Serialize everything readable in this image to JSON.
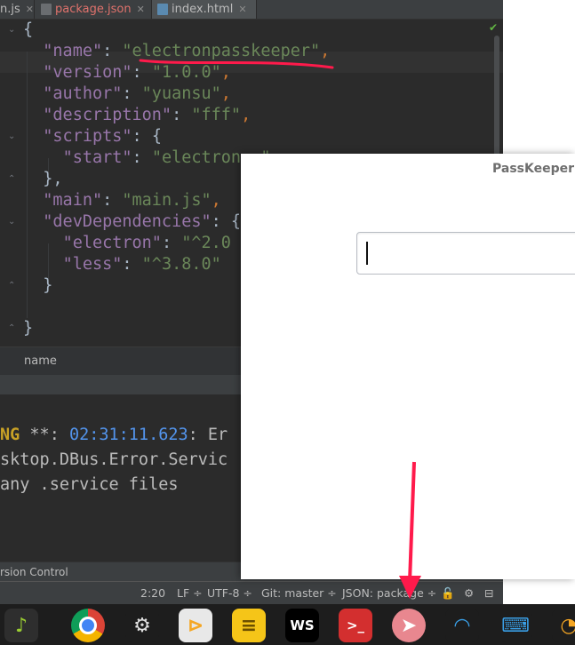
{
  "tabs": [
    {
      "label": "n.js"
    },
    {
      "label": "package.json",
      "modified": true
    },
    {
      "label": "index.html"
    }
  ],
  "code_lines": [
    {
      "indent": "",
      "parts": [
        {
          "t": "{",
          "c": "p"
        }
      ]
    },
    {
      "indent": "  ",
      "key": "\"name\"",
      "value": "\"electronpasskeeper\"",
      "tail": ","
    },
    {
      "indent": "  ",
      "key": "\"version\"",
      "value": "\"1.0.0\"",
      "tail": ","
    },
    {
      "indent": "  ",
      "key": "\"author\"",
      "value": "\"yuansu\"",
      "tail": ","
    },
    {
      "indent": "  ",
      "key": "\"description\"",
      "value": "\"fff\"",
      "tail": ","
    },
    {
      "indent": "  ",
      "key": "\"scripts\"",
      "value": "{",
      "tail": ""
    },
    {
      "indent": "    ",
      "key": "\"start\"",
      "value": "\"electron .\"",
      "tail": ""
    },
    {
      "indent": "  ",
      "raw": "},"
    },
    {
      "indent": "  ",
      "key": "\"main\"",
      "value": "\"main.js\"",
      "tail": ","
    },
    {
      "indent": "  ",
      "key": "\"devDependencies\"",
      "value": "{",
      "tail": ""
    },
    {
      "indent": "    ",
      "key": "\"electron\"",
      "value": "\"^2.0",
      "tail": ""
    },
    {
      "indent": "    ",
      "key": "\"less\"",
      "value": "\"^3.8.0\"",
      "tail": ""
    },
    {
      "indent": "  ",
      "raw": "}"
    },
    {
      "indent": "",
      "raw": ""
    },
    {
      "indent": "",
      "raw": "}"
    }
  ],
  "breadcrumb": "name",
  "console": {
    "line1_prefix": "NG",
    "line1_mid": " **: ",
    "line1_time": "02:31:11.623",
    "line1_end": ": Er",
    "line2": "sktop.DBus.Error.Servic",
    "line3": "any .service files"
  },
  "tool_tab": "rsion Control",
  "status": {
    "position": "2:20",
    "line_sep": "LF ÷",
    "encoding": "UTF-8 ÷",
    "git": "Git: master ÷",
    "schema": "JSON: package ÷"
  },
  "window": {
    "title": "PassKeeper",
    "input_value": ""
  },
  "dock": [
    {
      "name": "music-icon",
      "color": "#2e2e2e",
      "glyph": "♪",
      "fg": "#9acd32"
    },
    {
      "name": "chrome-icon",
      "color": "#1d1d1d",
      "glyph": "",
      "fg": "#fff"
    },
    {
      "name": "settings-icon",
      "color": "#1d1d1d",
      "glyph": "⚙",
      "fg": "#e0e0e0"
    },
    {
      "name": "vscode-icon",
      "color": "#e8e8e8",
      "glyph": "⊳",
      "fg": "#f5a623"
    },
    {
      "name": "notes-icon",
      "color": "#f5c518",
      "glyph": "≡",
      "fg": "#6b4f00"
    },
    {
      "name": "webstorm-icon",
      "color": "#000000",
      "glyph": "WS",
      "fg": "#ffffff"
    },
    {
      "name": "terminal-icon",
      "color": "#d32f2f",
      "glyph": ">_",
      "fg": "#ffffff"
    },
    {
      "name": "paperplane-icon",
      "color": "#e8878f",
      "glyph": "➤",
      "fg": "#ffffff"
    },
    {
      "name": "wifi-icon",
      "color": "#1d1d1d",
      "glyph": "◠",
      "fg": "#3aa0e8"
    },
    {
      "name": "keyboard-icon",
      "color": "#1d1d1d",
      "glyph": "⌨",
      "fg": "#3aa0e8"
    },
    {
      "name": "clock-icon",
      "color": "#1d1d1d",
      "glyph": "◔",
      "fg": "#f5a623"
    }
  ],
  "colors": {
    "annotation": "#ff1a4b",
    "editor_bg": "#2b2b2b"
  }
}
